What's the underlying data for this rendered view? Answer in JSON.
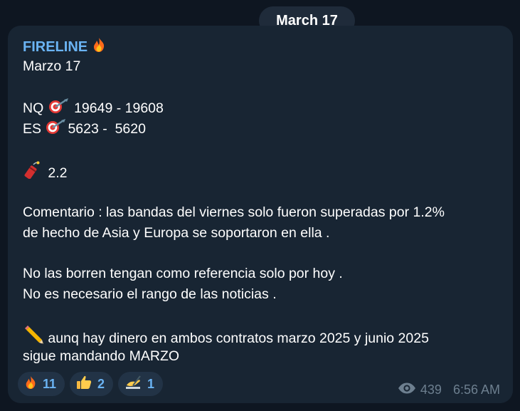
{
  "date_pill": "March 17",
  "message": {
    "sender": "FIRELINE",
    "sender_icon": "fire-icon",
    "lines": {
      "l1": "Marzo 17",
      "l2_prefix": "NQ ",
      "l2_icon": "target-icon",
      "l2_value": " 19649 - 19608",
      "l3_prefix": "ES ",
      "l3_icon": "target-icon",
      "l3_value": "5623 -  5620",
      "l4_icon": "firecracker-icon",
      "l4_value": " 2.2",
      "l5": "Comentario : las bandas del viernes solo fueron superadas por 1.2%",
      "l6": "de hecho de Asia y Europa se soportaron en ella .",
      "l7": "No las borren tengan como referencia solo por hoy .",
      "l8": "No es necesario el rango de las noticias .",
      "l9_icon": "pencil-icon",
      "l9_value": " aunq hay dinero en ambos contratos marzo 2025 y junio 2025",
      "l10": "sigue mandando MARZO"
    }
  },
  "reactions": [
    {
      "icon": "fire-icon",
      "count": "11"
    },
    {
      "icon": "thumbs-up-icon",
      "count": "2"
    },
    {
      "icon": "writing-hand-icon",
      "count": "1"
    }
  ],
  "meta": {
    "views_icon": "eye-icon",
    "views": "439",
    "time": "6:56 AM"
  },
  "colors": {
    "background": "#0e1621",
    "bubble": "#182533",
    "sender": "#6ab3f3",
    "reaction_bg": "#223346",
    "meta": "#6d7f8f"
  }
}
